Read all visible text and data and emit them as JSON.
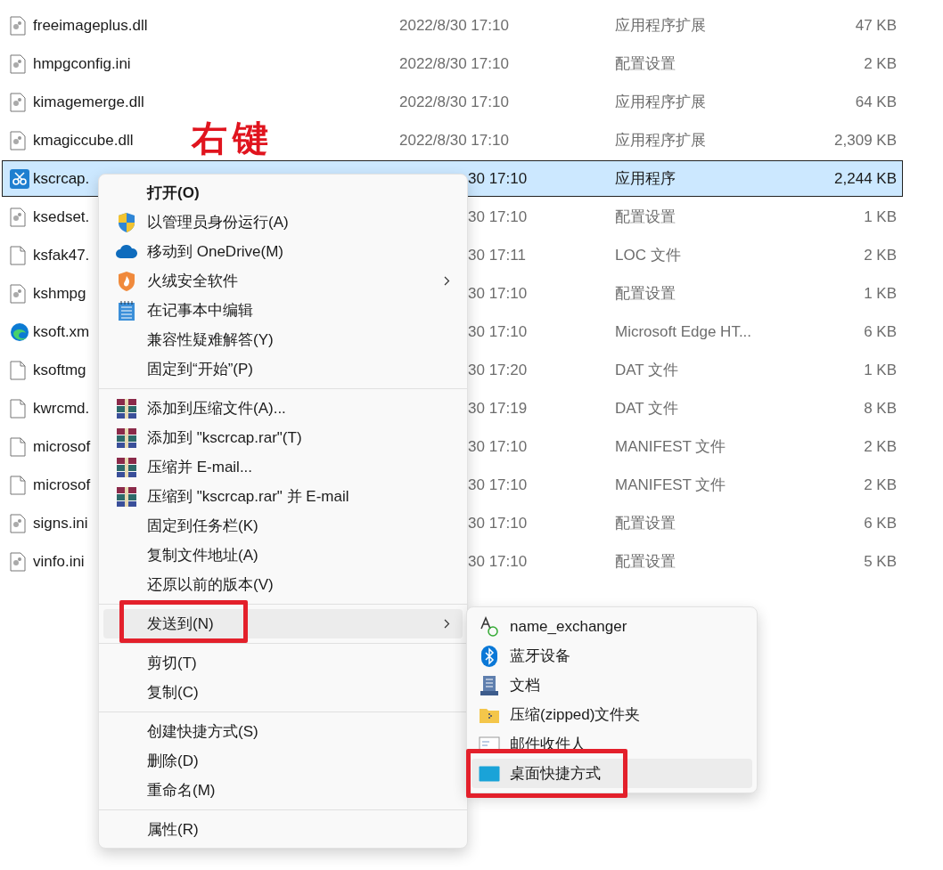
{
  "files": [
    {
      "kind": "dll",
      "name": "freeimageplus.dll",
      "date": "2022/8/30 17:10",
      "type": "应用程序扩展",
      "size": "47 KB",
      "selected": false,
      "under_menu": false
    },
    {
      "kind": "config",
      "name": "hmpgconfig.ini",
      "date": "2022/8/30 17:10",
      "type": "配置设置",
      "size": "2 KB",
      "selected": false,
      "under_menu": false
    },
    {
      "kind": "dll",
      "name": "kimagemerge.dll",
      "date": "2022/8/30 17:10",
      "type": "应用程序扩展",
      "size": "64 KB",
      "selected": false,
      "under_menu": false
    },
    {
      "kind": "dll",
      "name": "kmagiccube.dll",
      "date": "2022/8/30 17:10",
      "type": "应用程序扩展",
      "size": "2,309 KB",
      "selected": false,
      "under_menu": false
    },
    {
      "kind": "app",
      "name": "kscrcap.",
      "date": "30 17:10",
      "type": "应用程序",
      "size": "2,244 KB",
      "selected": true,
      "under_menu": true
    },
    {
      "kind": "config",
      "name": "ksedset.",
      "date": "30 17:10",
      "type": "配置设置",
      "size": "1 KB",
      "selected": false,
      "under_menu": true
    },
    {
      "kind": "blank",
      "name": "ksfak47.",
      "date": "30 17:11",
      "type": "LOC 文件",
      "size": "2 KB",
      "selected": false,
      "under_menu": true
    },
    {
      "kind": "config",
      "name": "kshmpg",
      "date": "30 17:10",
      "type": "配置设置",
      "size": "1 KB",
      "selected": false,
      "under_menu": true
    },
    {
      "kind": "edge",
      "name": "ksoft.xm",
      "date": "30 17:10",
      "type": "Microsoft Edge HT...",
      "size": "6 KB",
      "selected": false,
      "under_menu": true
    },
    {
      "kind": "blank",
      "name": "ksoftmg",
      "date": "30 17:20",
      "type": "DAT 文件",
      "size": "1 KB",
      "selected": false,
      "under_menu": true
    },
    {
      "kind": "blank",
      "name": "kwrcmd.",
      "date": "30 17:19",
      "type": "DAT 文件",
      "size": "8 KB",
      "selected": false,
      "under_menu": true
    },
    {
      "kind": "blank",
      "name": "microsof",
      "date": "30 17:10",
      "type": "MANIFEST 文件",
      "size": "2 KB",
      "selected": false,
      "under_menu": true
    },
    {
      "kind": "blank",
      "name": "microsof",
      "date": "30 17:10",
      "type": "MANIFEST 文件",
      "size": "2 KB",
      "selected": false,
      "under_menu": true
    },
    {
      "kind": "config",
      "name": "signs.ini",
      "date": "30 17:10",
      "type": "配置设置",
      "size": "6 KB",
      "selected": false,
      "under_menu": true
    },
    {
      "kind": "config",
      "name": "vinfo.ini",
      "date": "30 17:10",
      "type": "配置设置",
      "size": "5 KB",
      "selected": false,
      "under_menu": true
    }
  ],
  "annotation": {
    "text": "右键"
  },
  "context_menu": [
    {
      "kind": "plain",
      "label": "打开(O)",
      "bold": true,
      "submenu": false,
      "selected": false,
      "highlighted": false
    },
    {
      "kind": "shield",
      "label": "以管理员身份运行(A)",
      "bold": false,
      "submenu": false,
      "selected": false,
      "highlighted": false
    },
    {
      "kind": "cloud",
      "label": "移动到 OneDrive(M)",
      "bold": false,
      "submenu": false,
      "selected": false,
      "highlighted": false
    },
    {
      "kind": "flame",
      "label": "火绒安全软件",
      "bold": false,
      "submenu": true,
      "selected": false,
      "highlighted": false
    },
    {
      "kind": "notepad",
      "label": "在记事本中编辑",
      "bold": false,
      "submenu": false,
      "selected": false,
      "highlighted": false
    },
    {
      "kind": "plain",
      "label": "兼容性疑难解答(Y)",
      "bold": false,
      "submenu": false,
      "selected": false,
      "highlighted": false
    },
    {
      "kind": "plain",
      "label": "固定到“开始”(P)",
      "bold": false,
      "submenu": false,
      "selected": false,
      "highlighted": false
    },
    {
      "kind": "separator"
    },
    {
      "kind": "archive",
      "label": "添加到压缩文件(A)...",
      "bold": false,
      "submenu": false,
      "selected": false,
      "highlighted": false
    },
    {
      "kind": "archive",
      "label": "添加到 \"kscrcap.rar\"(T)",
      "bold": false,
      "submenu": false,
      "selected": false,
      "highlighted": false
    },
    {
      "kind": "archive",
      "label": "压缩并 E-mail...",
      "bold": false,
      "submenu": false,
      "selected": false,
      "highlighted": false
    },
    {
      "kind": "archive",
      "label": "压缩到 \"kscrcap.rar\" 并 E-mail",
      "bold": false,
      "submenu": false,
      "selected": false,
      "highlighted": false
    },
    {
      "kind": "plain",
      "label": "固定到任务栏(K)",
      "bold": false,
      "submenu": false,
      "selected": false,
      "highlighted": false
    },
    {
      "kind": "plain",
      "label": "复制文件地址(A)",
      "bold": false,
      "submenu": false,
      "selected": false,
      "highlighted": false
    },
    {
      "kind": "plain",
      "label": "还原以前的版本(V)",
      "bold": false,
      "submenu": false,
      "selected": false,
      "highlighted": false
    },
    {
      "kind": "separator"
    },
    {
      "kind": "plain",
      "label": "发送到(N)",
      "bold": false,
      "submenu": true,
      "selected": true,
      "highlighted": true
    },
    {
      "kind": "separator"
    },
    {
      "kind": "plain",
      "label": "剪切(T)",
      "bold": false,
      "submenu": false,
      "selected": false,
      "highlighted": false
    },
    {
      "kind": "plain",
      "label": "复制(C)",
      "bold": false,
      "submenu": false,
      "selected": false,
      "highlighted": false
    },
    {
      "kind": "separator"
    },
    {
      "kind": "plain",
      "label": "创建快捷方式(S)",
      "bold": false,
      "submenu": false,
      "selected": false,
      "highlighted": false
    },
    {
      "kind": "plain",
      "label": "删除(D)",
      "bold": false,
      "submenu": false,
      "selected": false,
      "highlighted": false
    },
    {
      "kind": "plain",
      "label": "重命名(M)",
      "bold": false,
      "submenu": false,
      "selected": false,
      "highlighted": false
    },
    {
      "kind": "separator"
    },
    {
      "kind": "plain",
      "label": "属性(R)",
      "bold": false,
      "submenu": false,
      "selected": false,
      "highlighted": false
    }
  ],
  "send_to_menu": [
    {
      "kind": "exchanger",
      "label": "name_exchanger",
      "selected": false,
      "highlighted": false
    },
    {
      "kind": "bluetooth",
      "label": "蓝牙设备",
      "selected": false,
      "highlighted": false
    },
    {
      "kind": "documents",
      "label": "文档",
      "selected": false,
      "highlighted": false
    },
    {
      "kind": "zipfolder",
      "label": "压缩(zipped)文件夹",
      "selected": false,
      "highlighted": false
    },
    {
      "kind": "mail",
      "label": "邮件收件人",
      "selected": false,
      "highlighted": false
    },
    {
      "kind": "desktop",
      "label": "桌面快捷方式",
      "selected": true,
      "highlighted": true
    }
  ]
}
